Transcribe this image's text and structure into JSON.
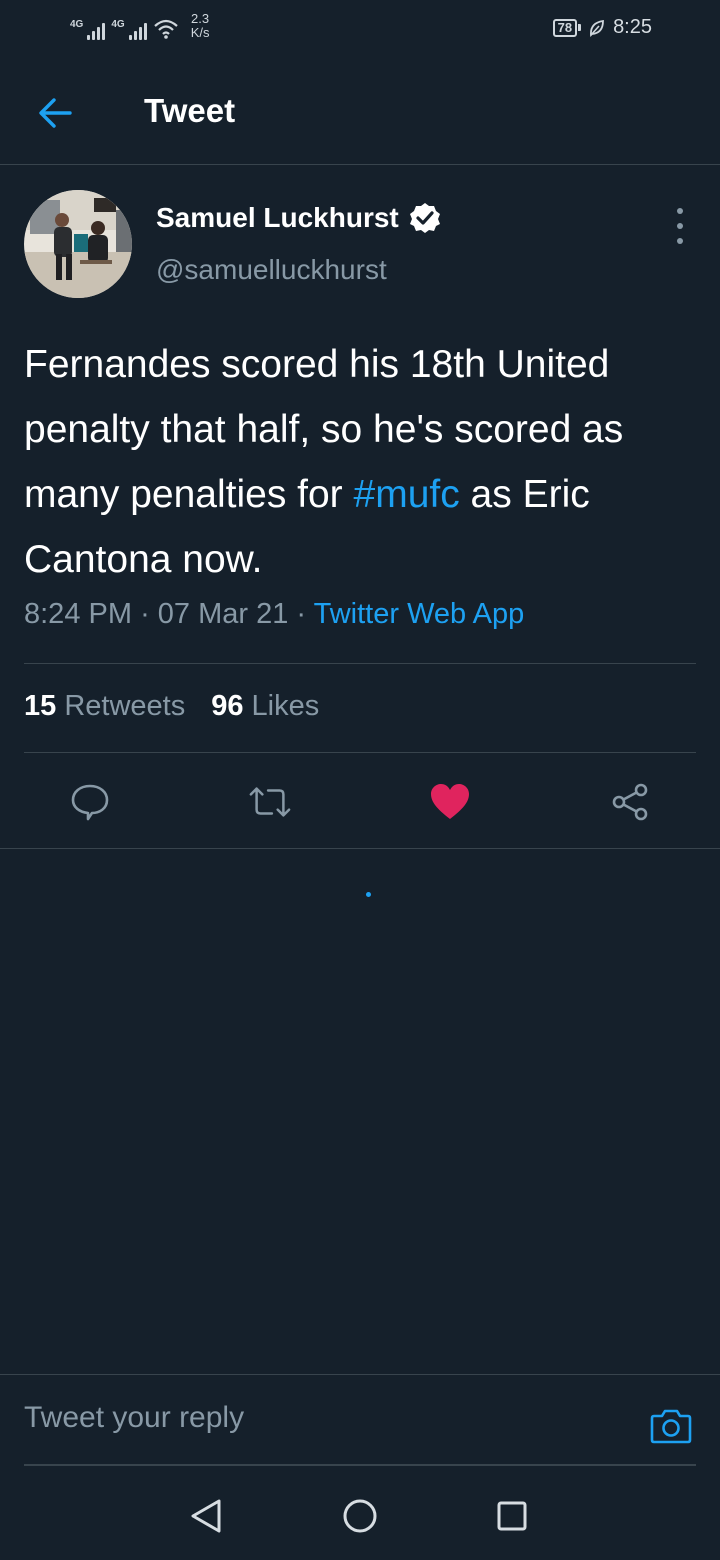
{
  "status_bar": {
    "network_1": "4G",
    "network_2": "4G",
    "speed_value": "2.3",
    "speed_unit": "K/s",
    "battery": "78",
    "time": "8:25"
  },
  "header": {
    "title": "Tweet"
  },
  "tweet": {
    "author_name": "Samuel Luckhurst",
    "author_handle": "@samuelluckhurst",
    "text_before": "Fernandes scored his 18th United penalty that half, so he's scored as many penalties for ",
    "hashtag": "#mufc",
    "text_after": " as Eric Cantona now.",
    "time": "8:24 PM",
    "date": "07 Mar 21",
    "source": "Twitter Web App",
    "retweets_count": "15",
    "retweets_label": "Retweets",
    "likes_count": "96",
    "likes_label": "Likes",
    "liked": true
  },
  "reply_bar": {
    "placeholder": "Tweet your reply"
  },
  "colors": {
    "background": "#15202b",
    "accent": "#1da1f2",
    "like": "#e0245e",
    "muted": "#8899a6",
    "divider": "#38444d"
  },
  "icons": [
    "back-arrow-icon",
    "verified-badge-icon",
    "more-options-icon",
    "reply-icon",
    "retweet-icon",
    "heart-icon",
    "share-icon",
    "camera-icon",
    "nav-back-icon",
    "nav-home-icon",
    "nav-recents-icon"
  ]
}
